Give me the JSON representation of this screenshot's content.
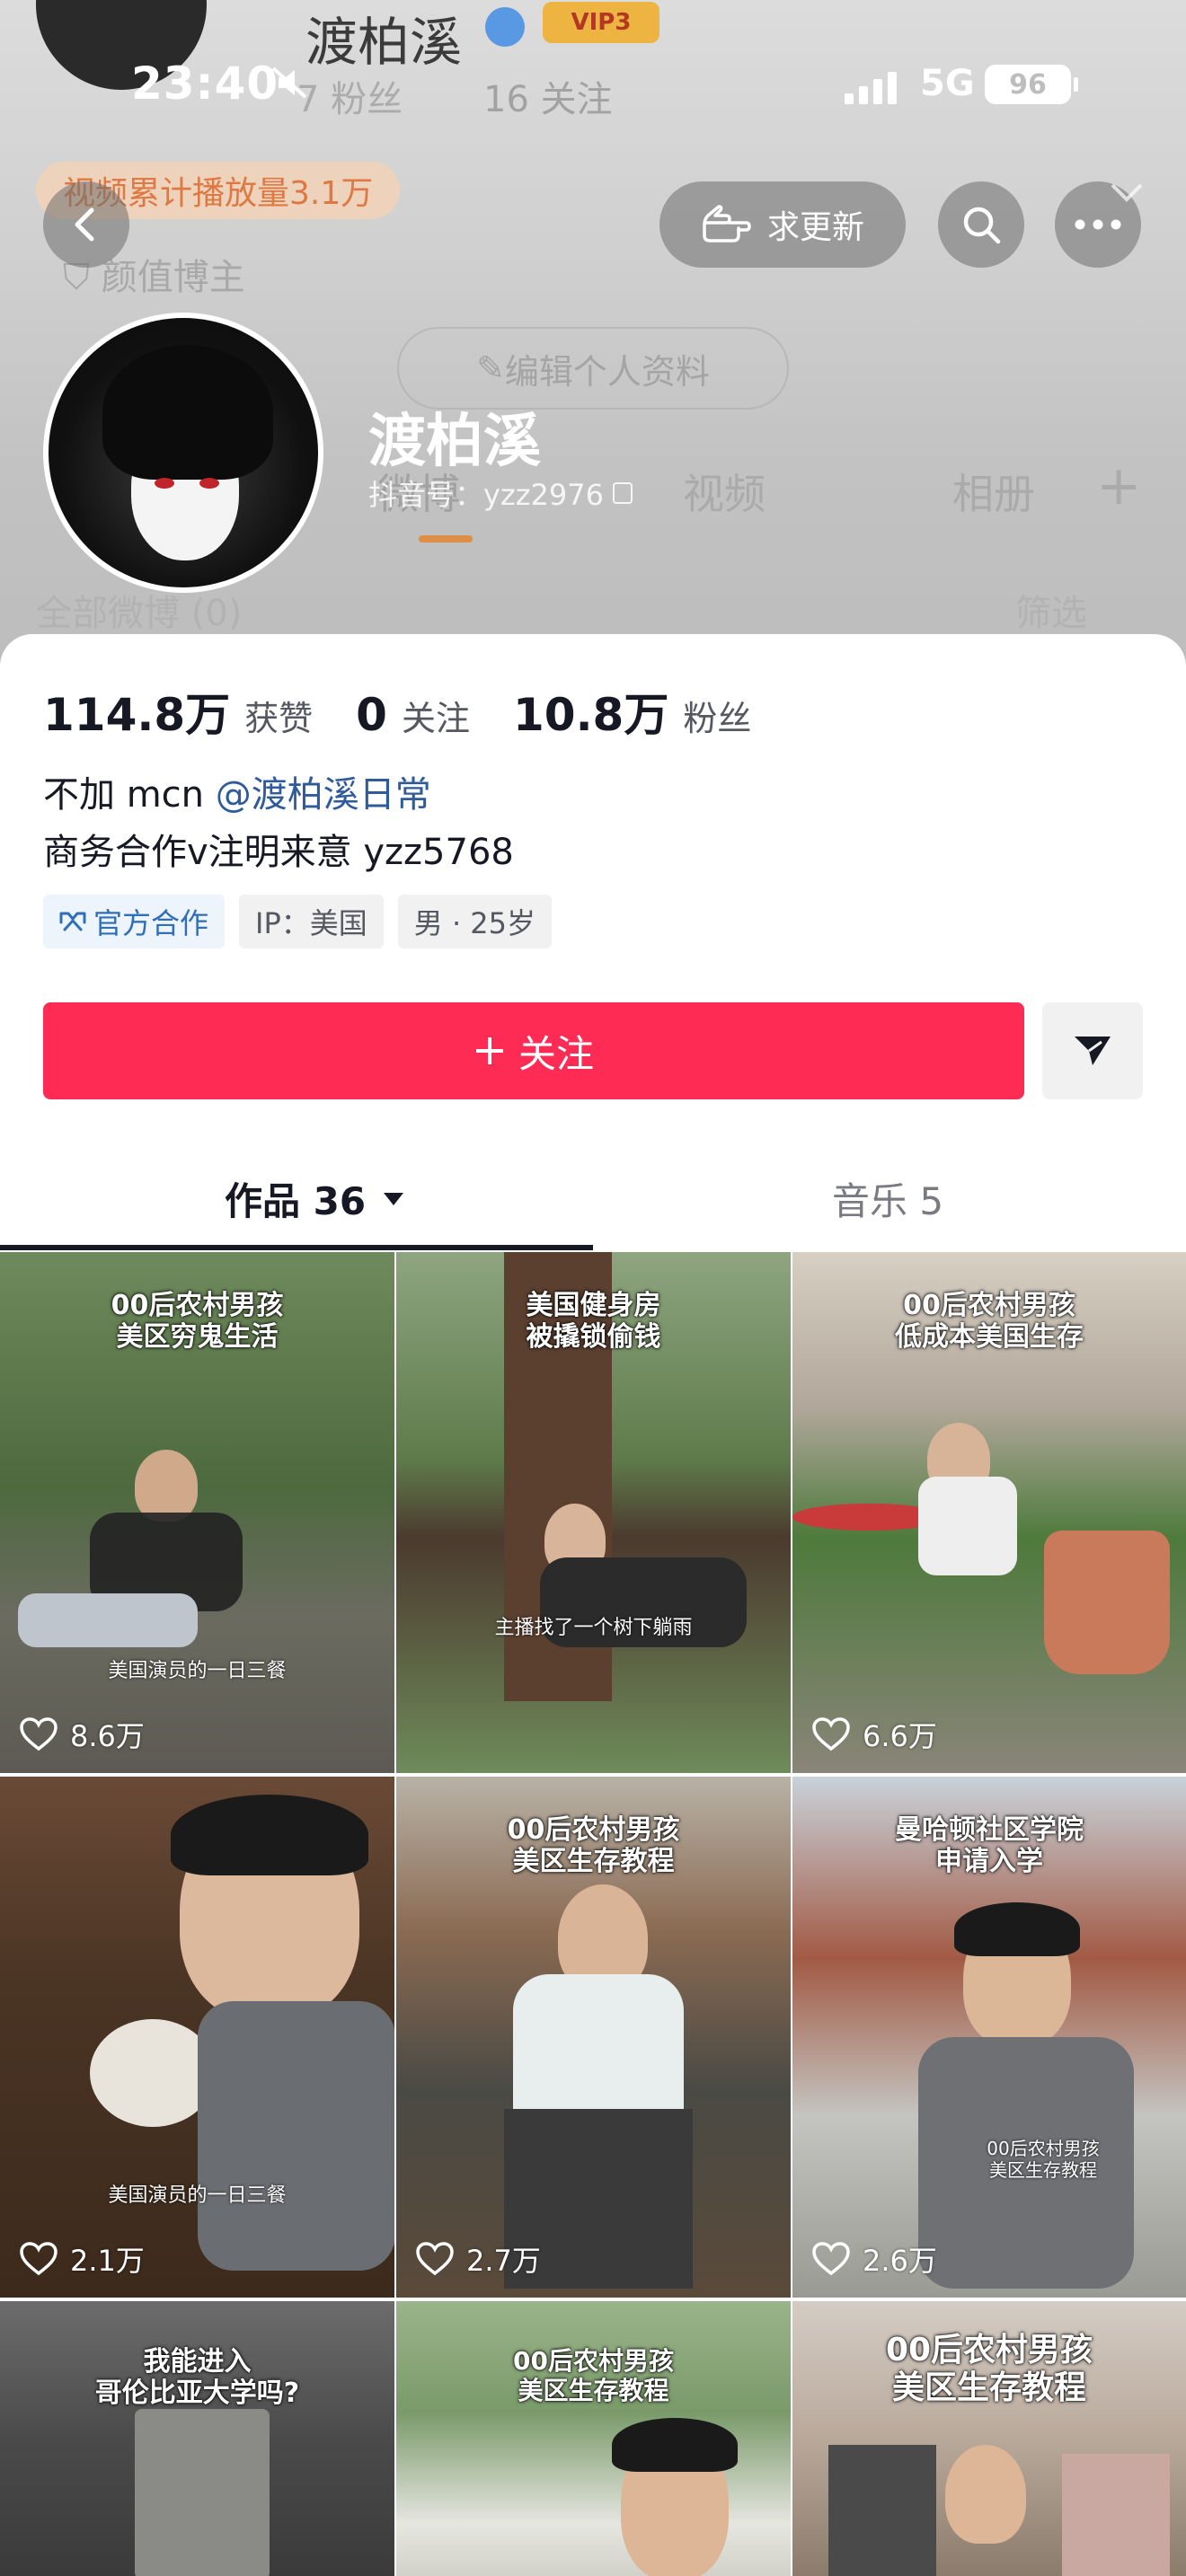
{
  "background_ghost": {
    "name_top": "渡柏溪",
    "vip": "VIP3",
    "fans": "7 粉丝",
    "follow": "16 关注",
    "play_pill": "视频累计播放量3.1万",
    "tag": "颜值博主",
    "edit": "编辑个人资料",
    "tabs": [
      "微博",
      "视频",
      "相册"
    ],
    "all": "全部微博 (0)",
    "filter": "筛选"
  },
  "status_bar": {
    "time": "23:40",
    "network": "5G",
    "battery": "96"
  },
  "top_nav": {
    "update_label": "求更新"
  },
  "profile": {
    "name": "渡柏溪",
    "douyin_id": "抖音号：yzz2976"
  },
  "stats": [
    {
      "value": "114.8万",
      "label": "获赞"
    },
    {
      "value": "0",
      "label": "关注"
    },
    {
      "value": "10.8万",
      "label": "粉丝"
    }
  ],
  "bio": {
    "line1_prefix": "不加 mcn ",
    "line1_link": "@渡柏溪日常",
    "line2": "商务合作v注明来意 yzz5768"
  },
  "tags": [
    "官方合作",
    "IP：美国",
    "男 · 25岁"
  ],
  "actions": {
    "follow_label": "关注"
  },
  "tabs": {
    "works": "作品 36",
    "music": "音乐 5"
  },
  "videos": [
    {
      "title": "00后农村男孩\n美区穷鬼生活",
      "subtitle": "美国演员的一日三餐",
      "likes": "8.6万"
    },
    {
      "title": "美国健身房\n被撬锁偷钱",
      "subtitle": "主播找了一个树下躺雨",
      "likes": ""
    },
    {
      "title": "00后农村男孩\n低成本美国生存",
      "subtitle": "",
      "likes": "6.6万"
    },
    {
      "title": "",
      "subtitle": "美国演员的一日三餐",
      "likes": "2.1万"
    },
    {
      "title": "00后农村男孩\n美区生存教程",
      "subtitle": "",
      "likes": "2.7万"
    },
    {
      "title": "曼哈顿社区学院\n申请入学",
      "subtitle": "00后农村男孩\n美区生存教程",
      "likes": "2.6万"
    },
    {
      "title": "我能进入\n哥伦比亚大学吗?",
      "subtitle": "",
      "likes": ""
    },
    {
      "title": "00后农村男孩\n美区生存教程",
      "subtitle": "",
      "likes": ""
    },
    {
      "title": "00后农村男孩\n美区生存教程",
      "subtitle": "",
      "likes": ""
    }
  ],
  "colors": {
    "accent": "#fe2c55",
    "link": "#2f5b9b",
    "official_tag": "#2f6fb8",
    "text_primary": "#161823",
    "text_secondary": "#555861"
  }
}
